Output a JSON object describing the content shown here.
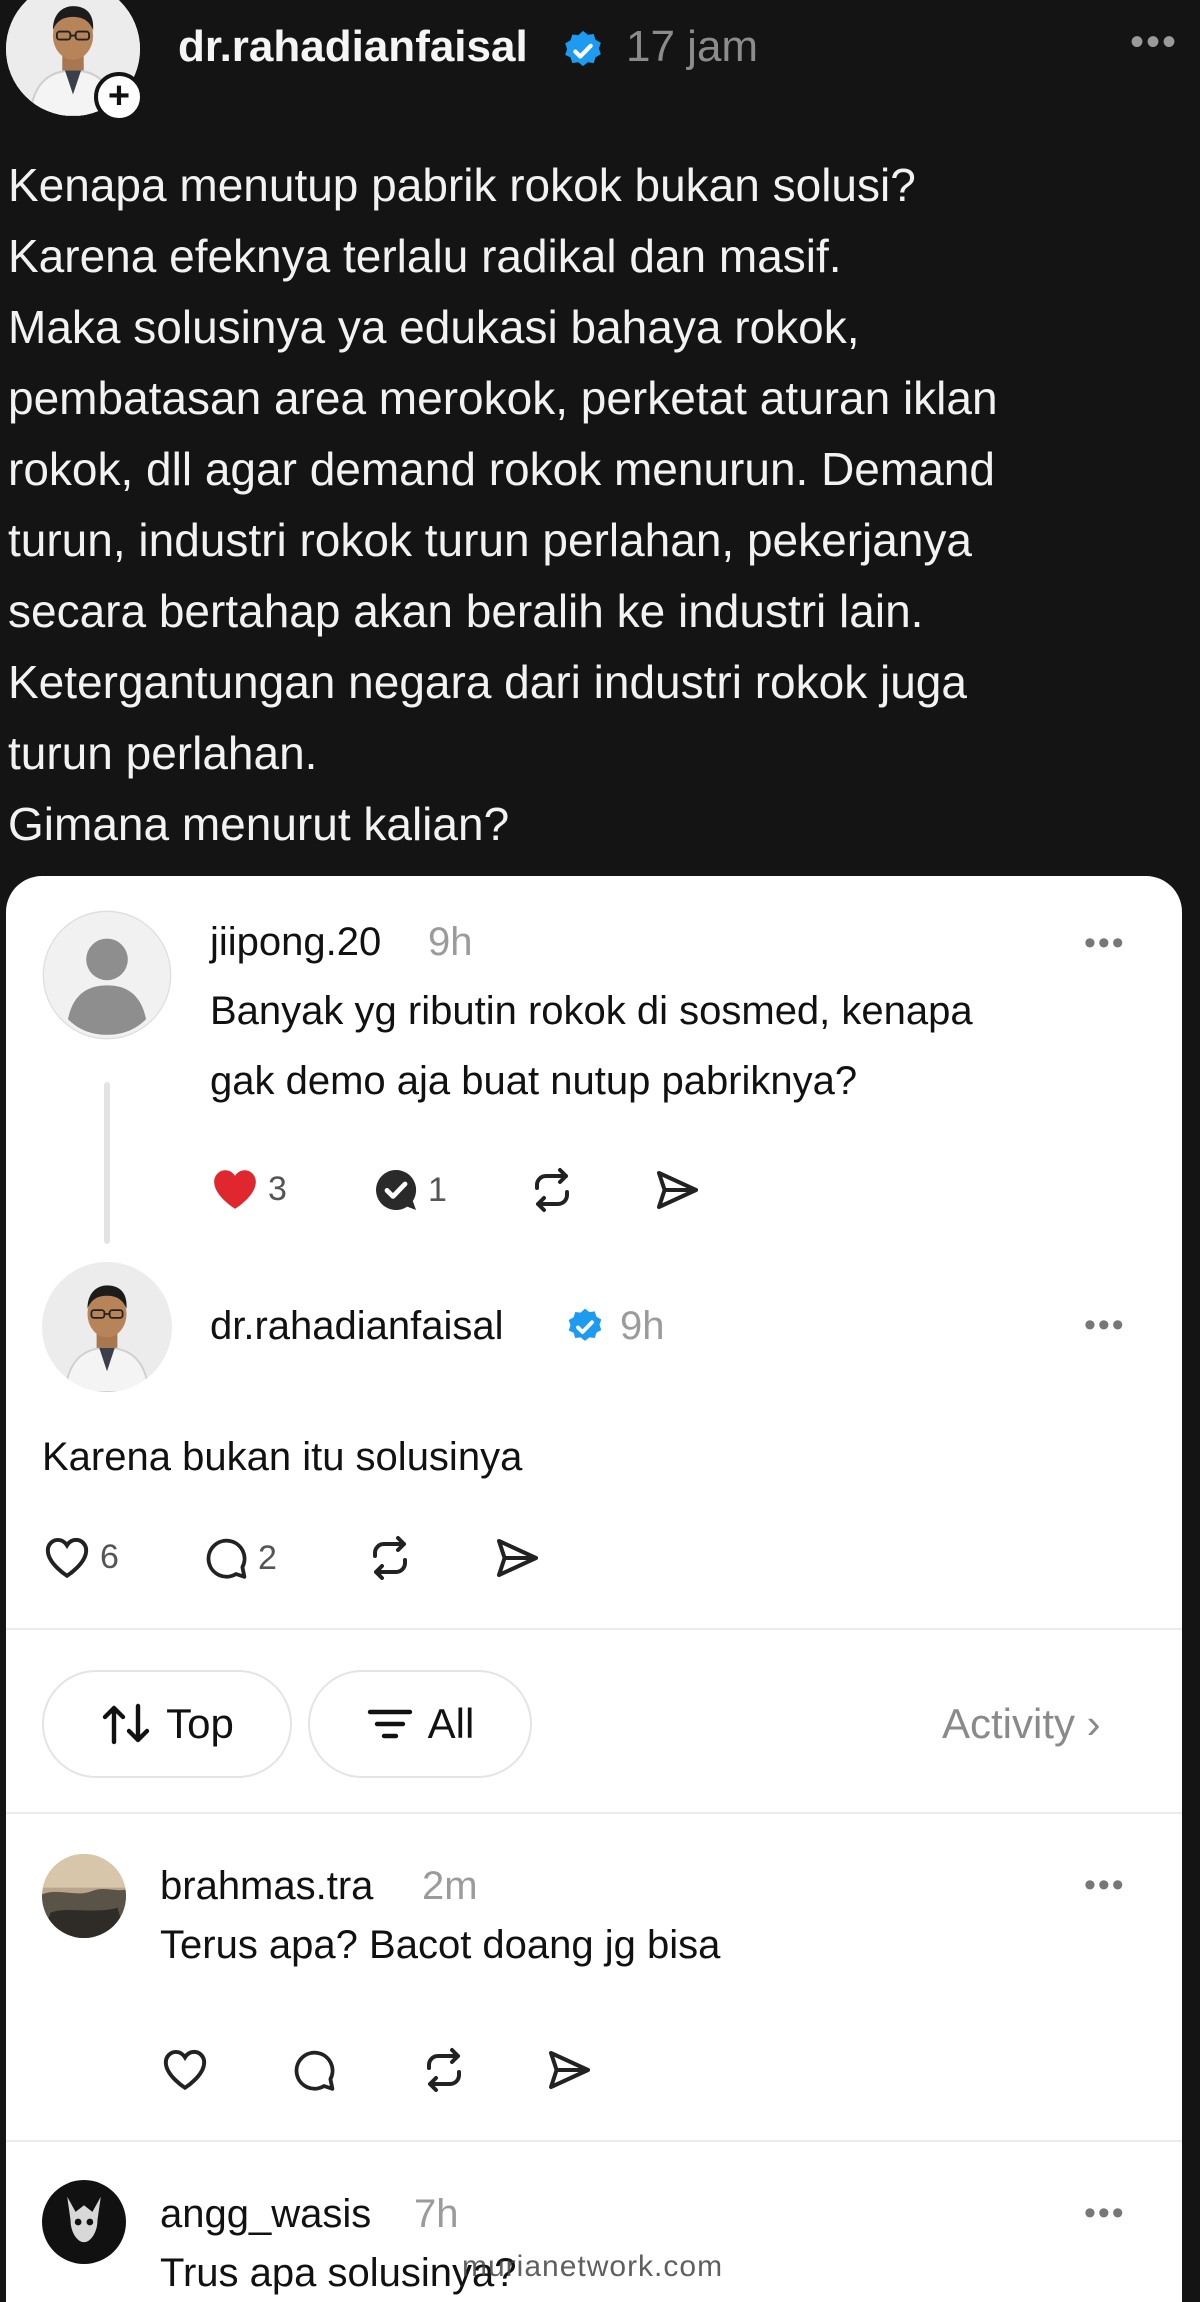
{
  "post": {
    "username": "dr.rahadianfaisal",
    "time": "17 jam",
    "more": "•••",
    "plus": "+",
    "text": "Kenapa menutup pabrik rokok bukan solusi?\nKarena efeknya terlalu radikal dan masif.\nMaka solusinya ya edukasi bahaya rokok,\npembatasan area merokok, perketat aturan iklan\nrokok, dll agar demand rokok menurun. Demand\nturun, industri rokok turun perlahan, pekerjanya\nsecara bertahap akan beralih ke industri lain.\nKetergantungan negara dari industri rokok juga\nturun perlahan.\nGimana menurut kalian?"
  },
  "reply1": {
    "username": "jiipong.20",
    "time": "9h",
    "more": "•••",
    "text": "Banyak yg ributin rokok di sosmed, kenapa\ngak demo aja buat nutup pabriknya?",
    "likes": "3",
    "replies": "1"
  },
  "reply2": {
    "username": "dr.rahadianfaisal",
    "time": "9h",
    "more": "•••",
    "text": "Karena bukan itu solusinya",
    "likes": "6",
    "replies": "2"
  },
  "filters": {
    "top_label": "Top",
    "all_label": "All",
    "activity_label": "Activity ›"
  },
  "comments": [
    {
      "username": "brahmas.tra",
      "time": "2m",
      "more": "•••",
      "text": "Terus apa? Bacot doang jg bisa"
    },
    {
      "username": "angg_wasis",
      "time": "7h",
      "more": "•••",
      "text": "Trus apa solusinya?"
    }
  ],
  "watermark": "murianetwork.com",
  "colors": {
    "verified": "#1d9bf0",
    "liked": "#e0262f",
    "background": "#141414",
    "card": "#ffffff"
  }
}
